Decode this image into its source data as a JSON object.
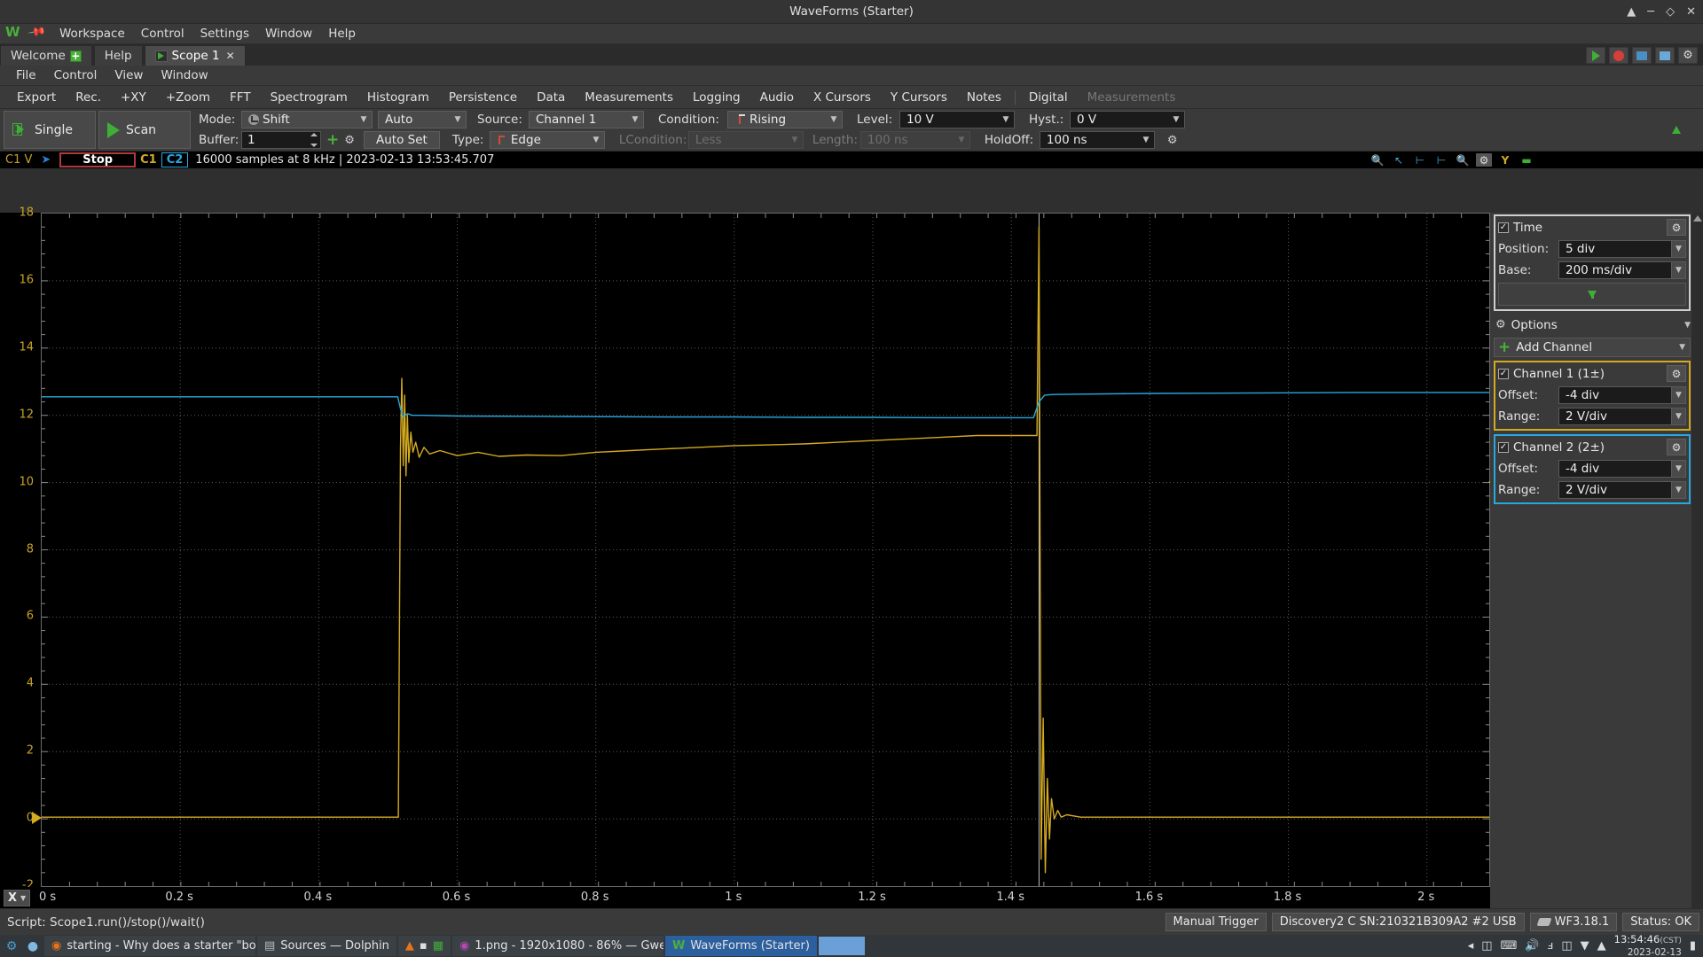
{
  "window": {
    "title": "WaveForms (Starter)",
    "logo": "W",
    "pin_icon": "pin-icon",
    "controls": [
      "collapse-icon",
      "minimize-icon",
      "maximize-icon",
      "close-icon"
    ]
  },
  "menubar": {
    "items": [
      "Workspace",
      "Control",
      "Settings",
      "Window",
      "Help"
    ]
  },
  "tabs": [
    {
      "label": "Welcome",
      "icon": "plus-icon",
      "active": false
    },
    {
      "label": "Help",
      "icon": "",
      "active": false
    },
    {
      "label": "Scope 1",
      "icon": "run-icon",
      "active": true,
      "closable": true
    }
  ],
  "tab_toolbar": [
    {
      "name": "run-button",
      "icon": "play-icon"
    },
    {
      "name": "record-button",
      "icon": "record-icon"
    },
    {
      "name": "layout-button",
      "icon": "panel-icon"
    },
    {
      "name": "view-button",
      "icon": "window-icon"
    },
    {
      "name": "settings-button",
      "icon": "gear-icon"
    }
  ],
  "submenu": {
    "items": [
      "File",
      "Control",
      "View",
      "Window"
    ]
  },
  "modbar": {
    "items": [
      {
        "label": "Export",
        "enabled": true
      },
      {
        "label": "Rec.",
        "enabled": true
      },
      {
        "label": "+XY",
        "enabled": true
      },
      {
        "label": "+Zoom",
        "enabled": true
      },
      {
        "label": "FFT",
        "enabled": true
      },
      {
        "label": "Spectrogram",
        "enabled": true
      },
      {
        "label": "Histogram",
        "enabled": true
      },
      {
        "label": "Persistence",
        "enabled": true
      },
      {
        "label": "Data",
        "enabled": true
      },
      {
        "label": "Measurements",
        "enabled": true
      },
      {
        "label": "Logging",
        "enabled": true
      },
      {
        "label": "Audio",
        "enabled": true
      },
      {
        "label": "X Cursors",
        "enabled": true
      },
      {
        "label": "Y Cursors",
        "enabled": true
      },
      {
        "label": "Notes",
        "enabled": true
      },
      {
        "label": "Digital",
        "enabled": true
      },
      {
        "label": "Measurements",
        "enabled": false
      }
    ]
  },
  "controls": {
    "single_button": "Single",
    "scan_button": "Scan",
    "mode_label": "Mode:",
    "mode_value": "Shift",
    "auto_value": "Auto",
    "source_label": "Source:",
    "source_value": "Channel 1",
    "condition_label": "Condition:",
    "condition_value": "Rising",
    "level_label": "Level:",
    "level_value": "10 V",
    "hyst_label": "Hyst.:",
    "hyst_value": "0 V",
    "buffer_label": "Buffer:",
    "buffer_value": "1",
    "add_buffer_icon": "plus-icon",
    "buffer_gear_icon": "gear-icon",
    "auto_set_button": "Auto Set",
    "type_label": "Type:",
    "type_value": "Edge",
    "lcondition_label": "LCondition:",
    "lcondition_value": "Less",
    "length_label": "Length:",
    "length_value": "100 ns",
    "holdoff_label": "HoldOff:",
    "holdoff_value": "100 ns",
    "trigger_gear_icon": "gear-icon",
    "export_arrow_icon": "arrow-up-icon"
  },
  "scope_status": {
    "channel_unit": "C1 V",
    "play_icon": "play-icon",
    "stop_button": "Stop",
    "c1_badge": "C1",
    "c2_badge": "C2",
    "info": "16000 samples at 8 kHz  |  2023-02-13 13:53:45.707",
    "icons": [
      "zoom-in-icon",
      "cursor-measure-icon",
      "h-measure-icon",
      "h-measure2-icon",
      "zoom-fit-icon",
      "gear-icon",
      "y-axis-icon",
      "minus-icon"
    ]
  },
  "right_panel": {
    "time": {
      "title": "Time",
      "checked": "✓",
      "gear_icon": "gear-icon",
      "position_label": "Position:",
      "position_value": "5 div",
      "base_label": "Base:",
      "base_value": "200 ms/div",
      "download_icon": "download-icon"
    },
    "options": {
      "label": "Options",
      "icon": "gear-icon"
    },
    "add_channel": {
      "label": "Add Channel",
      "icon": "plus-icon"
    },
    "channels": [
      {
        "title": "Channel 1 (1±)",
        "checked": "✓",
        "color": "#d4aa20",
        "offset_label": "Offset:",
        "offset_value": "-4 div",
        "range_label": "Range:",
        "range_value": "2 V/div",
        "gear_icon": "gear-icon"
      },
      {
        "title": "Channel 2 (2±)",
        "checked": "✓",
        "color": "#29a8df",
        "offset_label": "Offset:",
        "offset_value": "-4 div",
        "range_label": "Range:",
        "range_value": "2 V/div",
        "gear_icon": "gear-icon"
      }
    ]
  },
  "chart_data": {
    "type": "line",
    "title": "",
    "xlabel": "Time",
    "ylabel": "C1 V",
    "xlim": [
      0,
      2.09
    ],
    "ylim": [
      -2,
      18
    ],
    "x_ticks": [
      "0 s",
      "0.2 s",
      "0.4 s",
      "0.6 s",
      "0.8 s",
      "1 s",
      "1.2 s",
      "1.4 s",
      "1.6 s",
      "1.8 s",
      "2 s"
    ],
    "x_tick_values": [
      0,
      0.2,
      0.4,
      0.6,
      0.8,
      1.0,
      1.2,
      1.4,
      1.6,
      1.8,
      2.0
    ],
    "y_ticks": [
      "18",
      "16",
      "14",
      "12",
      "10",
      "8",
      "6",
      "4",
      "2",
      "0",
      "-2"
    ],
    "y_tick_values": [
      18,
      16,
      14,
      12,
      10,
      8,
      6,
      4,
      2,
      0,
      -2
    ],
    "grid": true,
    "legend": "none",
    "trigger_time_div": 1.44,
    "series": [
      {
        "name": "Channel 1",
        "color": "#d4aa20",
        "points": [
          [
            0.0,
            0.05
          ],
          [
            0.1,
            0.05
          ],
          [
            0.2,
            0.05
          ],
          [
            0.3,
            0.05
          ],
          [
            0.4,
            0.05
          ],
          [
            0.5,
            0.05
          ],
          [
            0.515,
            0.05
          ],
          [
            0.518,
            11.0
          ],
          [
            0.52,
            13.1
          ],
          [
            0.522,
            10.5
          ],
          [
            0.524,
            12.6
          ],
          [
            0.526,
            10.2
          ],
          [
            0.528,
            12.0
          ],
          [
            0.53,
            10.6
          ],
          [
            0.533,
            11.5
          ],
          [
            0.536,
            10.9
          ],
          [
            0.54,
            11.2
          ],
          [
            0.545,
            10.75
          ],
          [
            0.552,
            11.05
          ],
          [
            0.56,
            10.85
          ],
          [
            0.575,
            10.95
          ],
          [
            0.6,
            10.8
          ],
          [
            0.63,
            10.9
          ],
          [
            0.66,
            10.78
          ],
          [
            0.7,
            10.82
          ],
          [
            0.75,
            10.8
          ],
          [
            0.8,
            10.9
          ],
          [
            0.85,
            10.95
          ],
          [
            0.9,
            11.0
          ],
          [
            0.95,
            11.05
          ],
          [
            1.0,
            11.1
          ],
          [
            1.05,
            11.12
          ],
          [
            1.1,
            11.15
          ],
          [
            1.15,
            11.2
          ],
          [
            1.2,
            11.25
          ],
          [
            1.25,
            11.3
          ],
          [
            1.3,
            11.35
          ],
          [
            1.35,
            11.4
          ],
          [
            1.4,
            11.4
          ],
          [
            1.43,
            11.4
          ],
          [
            1.437,
            11.4
          ],
          [
            1.44,
            17.6
          ],
          [
            1.443,
            -1.2
          ],
          [
            1.446,
            3.0
          ],
          [
            1.449,
            -1.6
          ],
          [
            1.452,
            1.2
          ],
          [
            1.455,
            -0.6
          ],
          [
            1.458,
            0.6
          ],
          [
            1.462,
            0.0
          ],
          [
            1.467,
            0.25
          ],
          [
            1.472,
            0.05
          ],
          [
            1.48,
            0.12
          ],
          [
            1.5,
            0.05
          ],
          [
            1.6,
            0.05
          ],
          [
            1.7,
            0.05
          ],
          [
            1.8,
            0.05
          ],
          [
            1.9,
            0.05
          ],
          [
            2.0,
            0.05
          ],
          [
            2.09,
            0.05
          ]
        ]
      },
      {
        "name": "Channel 2",
        "color": "#29a8df",
        "points": [
          [
            0.0,
            12.55
          ],
          [
            0.1,
            12.55
          ],
          [
            0.2,
            12.55
          ],
          [
            0.3,
            12.55
          ],
          [
            0.4,
            12.55
          ],
          [
            0.5,
            12.55
          ],
          [
            0.514,
            12.55
          ],
          [
            0.518,
            12.2
          ],
          [
            0.522,
            11.95
          ],
          [
            0.528,
            12.05
          ],
          [
            0.535,
            12.0
          ],
          [
            0.55,
            12.0
          ],
          [
            0.6,
            11.98
          ],
          [
            0.7,
            11.97
          ],
          [
            0.8,
            11.96
          ],
          [
            0.9,
            11.95
          ],
          [
            1.0,
            11.95
          ],
          [
            1.1,
            11.94
          ],
          [
            1.2,
            11.94
          ],
          [
            1.3,
            11.93
          ],
          [
            1.4,
            11.93
          ],
          [
            1.432,
            11.93
          ],
          [
            1.44,
            12.4
          ],
          [
            1.448,
            12.6
          ],
          [
            1.46,
            12.62
          ],
          [
            1.5,
            12.63
          ],
          [
            1.6,
            12.65
          ],
          [
            1.7,
            12.66
          ],
          [
            1.8,
            12.67
          ],
          [
            1.9,
            12.68
          ],
          [
            2.0,
            12.68
          ],
          [
            2.09,
            12.68
          ]
        ]
      }
    ],
    "markers": {
      "y_left_trigger": 0.0,
      "y_right_level": 10.0,
      "trigger_line_x": 1.44
    }
  },
  "x_axis_button": "X",
  "bottom_status": {
    "script": "Script: Scope1.run()/stop()/wait()",
    "manual_trigger": "Manual Trigger",
    "device": "Discovery2 C SN:210321B309A2 #2 USB",
    "version": "WF3.18.1",
    "status": "Status: OK"
  },
  "taskbar": {
    "launcher_icons": [
      "kde-start-icon",
      "browser-icon"
    ],
    "tasks": [
      {
        "icon": "firefox-icon",
        "label": "starting - Why does a starter \"bo...",
        "active": false
      },
      {
        "icon": "dolphin-icon",
        "label": "Sources — Dolphin",
        "active": false
      },
      {
        "icon": "vlc-icon",
        "label": "",
        "active": false
      },
      {
        "icon": "gwenview-icon",
        "label": "1.png - 1920x1080 - 86%  — Gwe...",
        "active": false
      },
      {
        "icon": "waveforms-icon",
        "label": "WaveForms (Starter)",
        "active": true
      }
    ],
    "tray_icons": [
      "notification-icon",
      "device-icon",
      "keyboard-icon",
      "volume-icon",
      "bluetooth-icon",
      "battery-icon",
      "vpn-icon",
      "show-hidden-icon"
    ],
    "clock_time": "13:54:46",
    "clock_zone": "(CST)",
    "clock_date": "2023-02-13"
  }
}
